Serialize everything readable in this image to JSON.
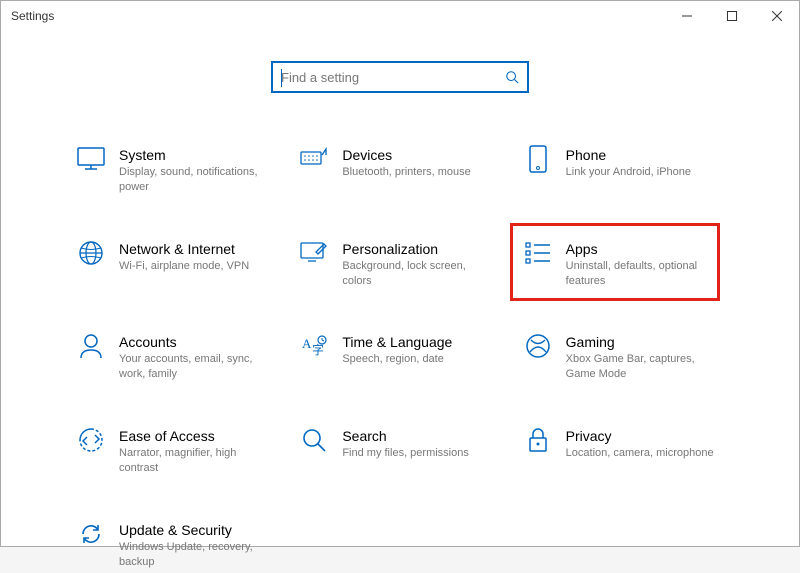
{
  "window": {
    "title": "Settings"
  },
  "search": {
    "placeholder": "Find a setting"
  },
  "tiles": {
    "system": {
      "title": "System",
      "sub": "Display, sound, notifications, power"
    },
    "devices": {
      "title": "Devices",
      "sub": "Bluetooth, printers, mouse"
    },
    "phone": {
      "title": "Phone",
      "sub": "Link your Android, iPhone"
    },
    "network": {
      "title": "Network & Internet",
      "sub": "Wi-Fi, airplane mode, VPN"
    },
    "personalization": {
      "title": "Personalization",
      "sub": "Background, lock screen, colors"
    },
    "apps": {
      "title": "Apps",
      "sub": "Uninstall, defaults, optional features"
    },
    "accounts": {
      "title": "Accounts",
      "sub": "Your accounts, email, sync, work, family"
    },
    "time": {
      "title": "Time & Language",
      "sub": "Speech, region, date"
    },
    "gaming": {
      "title": "Gaming",
      "sub": "Xbox Game Bar, captures, Game Mode"
    },
    "ease": {
      "title": "Ease of Access",
      "sub": "Narrator, magnifier, high contrast"
    },
    "searchCat": {
      "title": "Search",
      "sub": "Find my files, permissions"
    },
    "privacy": {
      "title": "Privacy",
      "sub": "Location, camera, microphone"
    },
    "update": {
      "title": "Update & Security",
      "sub": "Windows Update, recovery, backup"
    }
  }
}
